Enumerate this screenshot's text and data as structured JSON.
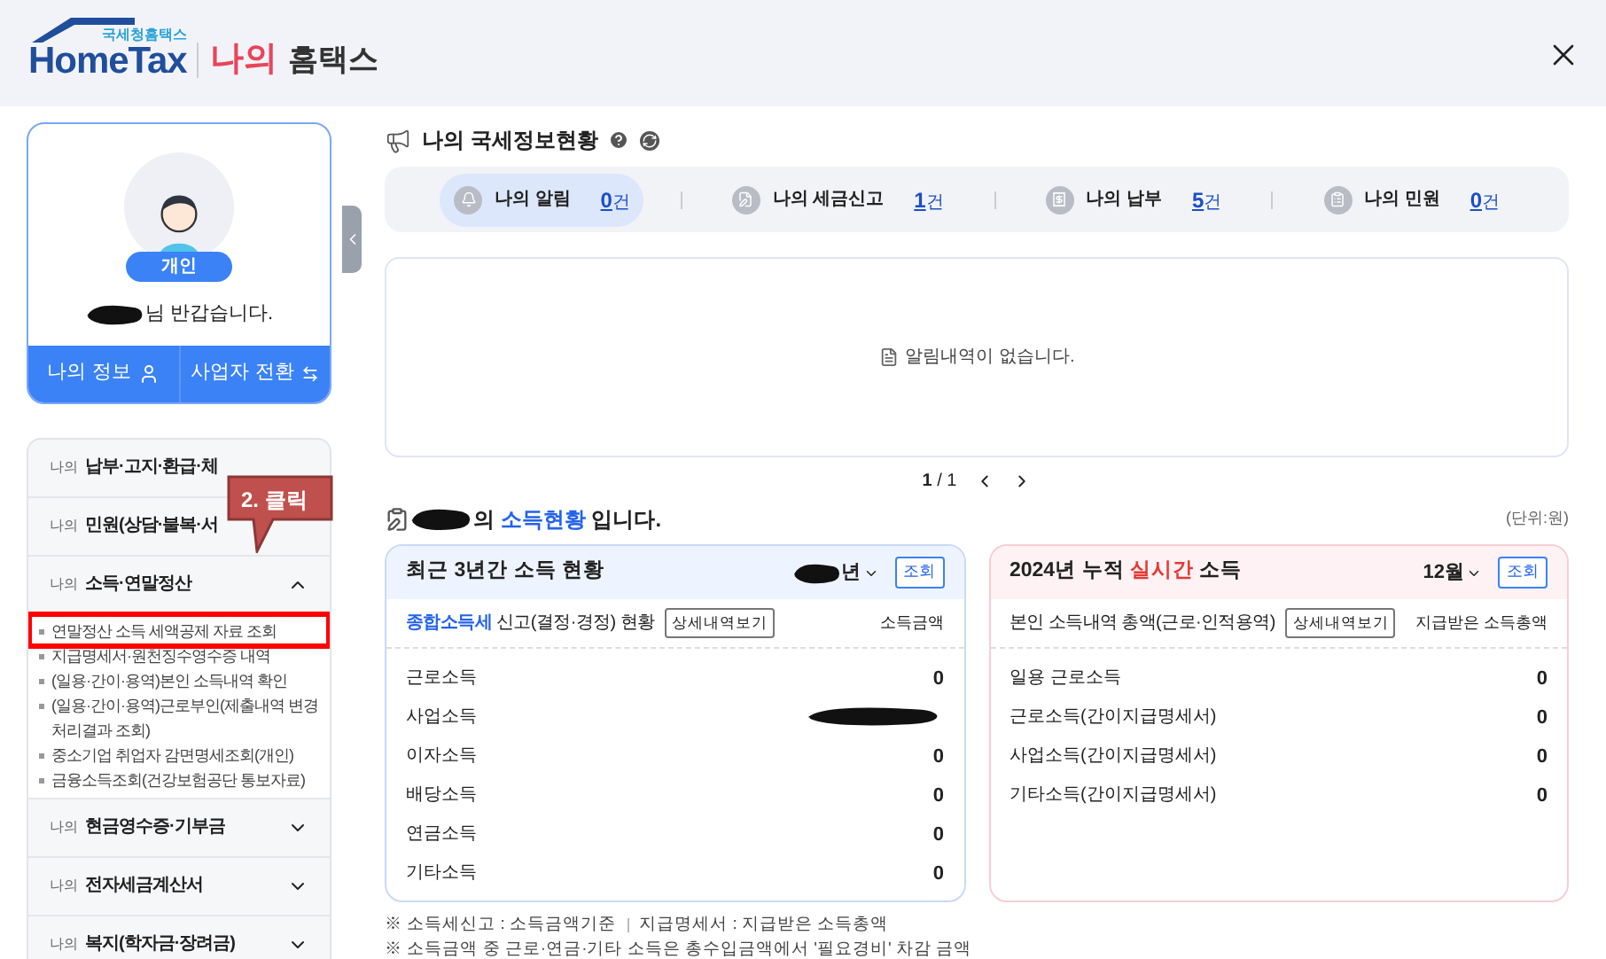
{
  "header": {
    "logo_small": "국세청홈택스",
    "logo": "HomeTax",
    "title_accent": "나의",
    "title": "홈택스"
  },
  "profile": {
    "badge": "개인",
    "greeting": "님 반갑습니다.",
    "buttons": [
      {
        "label": "나의 정보",
        "kind": "user"
      },
      {
        "label": "사업자 전환",
        "kind": "switch"
      }
    ]
  },
  "menu": [
    {
      "prefix": "나의",
      "label": "납부·고지·환급·체"
    },
    {
      "prefix": "나의",
      "label": "민원(상담·불복·서"
    },
    {
      "prefix": "나의",
      "label": "소득·연말정산",
      "expanded": true,
      "children": [
        {
          "label": "연말정산 소득 세액공제 자료 조회",
          "highlighted": true
        },
        {
          "label": "지급명세서·원천징수영수증 내역",
          "highlighted": false
        },
        {
          "label": "(일용·간이·용역)본인 소득내역 확인",
          "highlighted": false
        },
        {
          "label": "(일용·간이·용역)근로부인(제출내역 변경 처리결과 조회)",
          "highlighted": false
        },
        {
          "label": "중소기업 취업자 감면명세조회(개인)",
          "highlighted": false
        },
        {
          "label": "금융소득조회(건강보험공단 통보자료)",
          "highlighted": false
        }
      ]
    },
    {
      "prefix": "나의",
      "label": "현금영수증·기부금",
      "expanded": false
    },
    {
      "prefix": "나의",
      "label": "전자세금계산서",
      "expanded": false
    },
    {
      "prefix": "나의",
      "label": "복지(학자금·장려금)",
      "expanded": false
    }
  ],
  "callout": {
    "text": "2. 클릭"
  },
  "status": {
    "title": "나의 국세정보현황",
    "items": [
      {
        "label": "나의 알림",
        "count": "0",
        "unit": "건",
        "kind": "alert",
        "selected": true
      },
      {
        "label": "나의 세금신고",
        "count": "1",
        "unit": "건",
        "kind": "report",
        "selected": false
      },
      {
        "label": "나의 납부",
        "count": "5",
        "unit": "건",
        "kind": "payment",
        "selected": false
      },
      {
        "label": "나의 민원",
        "count": "0",
        "unit": "건",
        "kind": "petition",
        "selected": false
      }
    ],
    "empty_message": "알림내역이 없습니다.",
    "page_label": "**1** / 1"
  },
  "income": {
    "title_prefix": "의",
    "title_highlight": "소득현황",
    "title_suffix": "입니다.",
    "unit_note": "(단위:원)",
    "cards": [
      {
        "kind": "history",
        "title": "최근 3년간 소득 현황",
        "period": "년",
        "period_redacted": true,
        "query_button": "조회",
        "sub_highlight": "종합소득세",
        "sub_title": " 신고(결정·경정) 현황",
        "detail_button": "상세내역보기",
        "column": "소득금액",
        "rows": [
          {
            "label": "근로소득",
            "value": "0"
          },
          {
            "label": "사업소득",
            "redacted": true
          },
          {
            "label": "이자소득",
            "value": "0"
          },
          {
            "label": "배당소득",
            "value": "0"
          },
          {
            "label": "연금소득",
            "value": "0"
          },
          {
            "label": "기타소득",
            "value": "0"
          }
        ]
      },
      {
        "kind": "realtime",
        "title": "2024년 누적 ",
        "title_highlight": "실시간",
        "title_suffix": " 소득",
        "period": "12월",
        "period_redacted": false,
        "query_button": "조회",
        "sub_title": "본인 소득내역 총액(근로·인적용역)",
        "detail_button": "상세내역보기",
        "column": "지급받은 소득총액",
        "rows": [
          {
            "label": "일용 근로소득",
            "value": "0"
          },
          {
            "label": "근로소득(간이지급명세서)",
            "value": "0"
          },
          {
            "label": "사업소득(간이지급명세서)",
            "value": "0"
          },
          {
            "label": "기타소득(간이지급명세서)",
            "value": "0"
          }
        ]
      }
    ]
  },
  "notes": [
    {
      "parts": [
        "※ 소득세신고 : 소득금액기준",
        "지급명세서 : 지급받은 소득총액"
      ]
    },
    {
      "parts": [
        "※ 소득금액 중 근로·연금·기타 소득은 총수입금액에서 '필요경비' 차감 금액"
      ]
    }
  ]
}
